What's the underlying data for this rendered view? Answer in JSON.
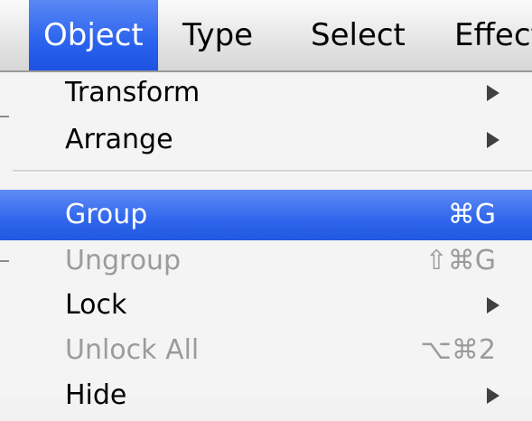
{
  "menubar": {
    "items": [
      {
        "label": "Object"
      },
      {
        "label": "Type"
      },
      {
        "label": "Select"
      },
      {
        "label": "Effect"
      }
    ]
  },
  "menu": {
    "items": [
      {
        "label": "Transform",
        "shortcut": "",
        "submenu": true
      },
      {
        "label": "Arrange",
        "shortcut": "",
        "submenu": true
      },
      {
        "label": "Group",
        "shortcut": "⌘G",
        "submenu": false,
        "state": "highlighted"
      },
      {
        "label": "Ungroup",
        "shortcut": "⇧⌘G",
        "submenu": false,
        "state": "disabled"
      },
      {
        "label": "Lock",
        "shortcut": "",
        "submenu": true
      },
      {
        "label": "Unlock All",
        "shortcut": "⌥⌘2",
        "submenu": false,
        "state": "disabled"
      },
      {
        "label": "Hide",
        "shortcut": "",
        "submenu": true
      }
    ]
  },
  "colors": {
    "highlight": "#2f66ec",
    "disabled_text": "#9b9b9b"
  }
}
